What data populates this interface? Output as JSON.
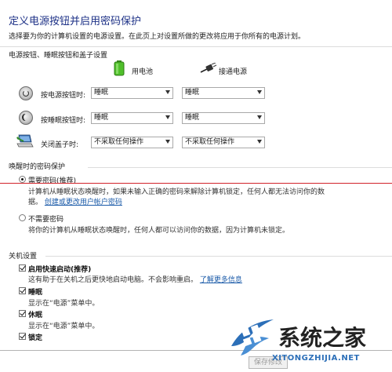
{
  "header": {
    "title": "定义电源按钮并启用密码保护",
    "subtitle": "选择要为你的计算机设置的电源设置。在此页上对设置所做的更改将应用于你所有的电源计划。"
  },
  "power_buttons": {
    "section_label": "电源按钮、睡眠按钮和盖子设置",
    "col_battery": "用电池",
    "col_plugged": "接通电源",
    "rows": [
      {
        "label": "按电源按钮时:",
        "battery": "睡眠",
        "plugged": "睡眠"
      },
      {
        "label": "按睡眠按钮时:",
        "battery": "睡眠",
        "plugged": "睡眠"
      },
      {
        "label": "关闭盖子时:",
        "battery": "不采取任何操作",
        "plugged": "不采取任何操作"
      }
    ]
  },
  "wake_password": {
    "section_label": "唤醒时的密码保护",
    "require": {
      "label": "需要密码(推荐)",
      "desc1": "计算机从睡眠状态唤醒时，如果未输入正确的密码来解除计算机锁定，任何人都无法访问你的数",
      "desc2": "据。",
      "link": "创建或更改用户帐户密码"
    },
    "no_require": {
      "label": "不需要密码",
      "desc": "将你的计算机从睡眠状态唤醒时，任何人都可以访问你的数据，因为计算机未锁定。"
    }
  },
  "shutdown": {
    "section_label": "关机设置",
    "fast_startup": {
      "label": "启用快速启动(推荐)",
      "desc": "这有助于在关机之后更快地启动电脑。不会影响重启。",
      "link": "了解更多信息"
    },
    "sleep": {
      "label": "睡眠",
      "desc": "显示在“电源”菜单中。"
    },
    "hibernate": {
      "label": "休眠",
      "desc": "显示在“电源”菜单中。"
    },
    "lock": {
      "label": "锁定"
    }
  },
  "footer": {
    "save_label": "保存修改"
  },
  "watermark": {
    "brand": "系统之家",
    "url": "XITONGZHIJIA.NET"
  },
  "colors": {
    "title_blue": "#1e3287",
    "link_blue": "#1a5aa8",
    "red_line": "#d2232a",
    "watermark_blue": "#2c6fb8"
  }
}
